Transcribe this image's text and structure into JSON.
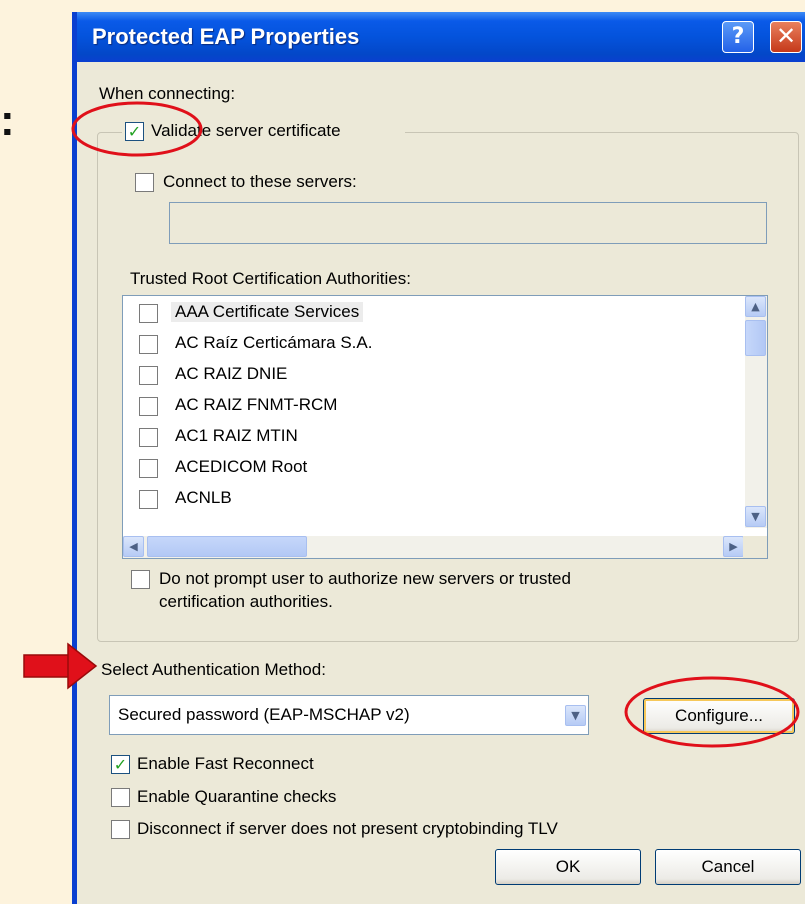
{
  "dialog": {
    "title": "Protected EAP Properties",
    "help_icon": "help-icon",
    "close_icon": "close-icon"
  },
  "side_text": ":",
  "when_connecting": {
    "label": "When connecting:",
    "validate_server_certificate": {
      "label": "Validate server certificate",
      "checked": true
    },
    "connect_to_servers": {
      "label": "Connect to these servers:",
      "checked": false,
      "value": ""
    },
    "trusted_root_label": "Trusted Root Certification Authorities:",
    "ca_list": [
      {
        "label": "AAA Certificate Services",
        "checked": false,
        "selected": true
      },
      {
        "label": "AC Raíz Certicámara S.A.",
        "checked": false
      },
      {
        "label": "AC RAIZ DNIE",
        "checked": false
      },
      {
        "label": "AC RAIZ FNMT-RCM",
        "checked": false
      },
      {
        "label": "AC1 RAIZ MTIN",
        "checked": false
      },
      {
        "label": "ACEDICOM Root",
        "checked": false
      },
      {
        "label": "ACNLB",
        "checked": false
      }
    ],
    "do_not_prompt": {
      "label_line1": "Do not prompt user to authorize new servers or trusted",
      "label_line2": "certification authorities.",
      "checked": false
    }
  },
  "auth_method": {
    "label": "Select Authentication Method:",
    "selected": "Secured password (EAP-MSCHAP v2)",
    "configure_label": "Configure..."
  },
  "options": [
    {
      "label": "Enable Fast Reconnect",
      "checked": true
    },
    {
      "label": "Enable Quarantine checks",
      "checked": false
    },
    {
      "label": "Disconnect if server does not present cryptobinding TLV",
      "checked": false
    }
  ],
  "buttons": {
    "ok": "OK",
    "cancel": "Cancel"
  },
  "colors": {
    "titlebar": "#0453dc",
    "dialog_bg": "#ece9d8",
    "page_bg": "#fdf3dd",
    "annotation_red": "#e0101a",
    "check_green": "#21a121"
  }
}
